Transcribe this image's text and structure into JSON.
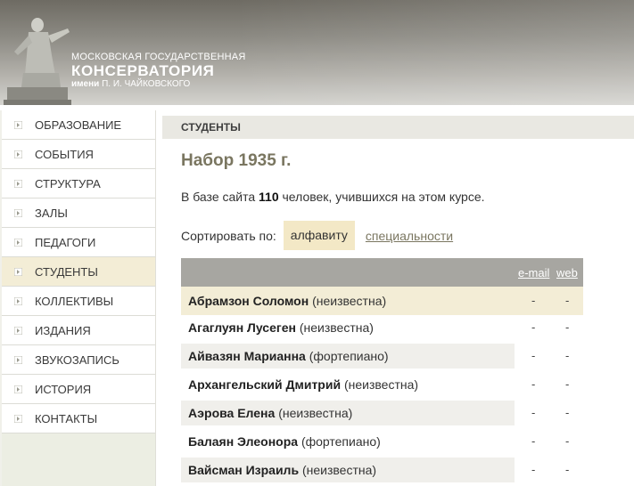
{
  "logo": {
    "line1": "МОСКОВСКАЯ ГОСУДАРСТВЕННАЯ",
    "line2": "КОНСЕРВАТОРИЯ",
    "line3_prefix": "имени",
    "line3_name": "П. И. ЧАЙКОВСКОГО"
  },
  "nav": {
    "items": [
      {
        "label": "ОБРАЗОВАНИЕ"
      },
      {
        "label": "СОБЫТИЯ"
      },
      {
        "label": "СТРУКТУРА"
      },
      {
        "label": "ЗАЛЫ"
      },
      {
        "label": "ПЕДАГОГИ"
      },
      {
        "label": "СТУДЕНТЫ"
      },
      {
        "label": "КОЛЛЕКТИВЫ"
      },
      {
        "label": "ИЗДАНИЯ"
      },
      {
        "label": "ЗВУКОЗАПИСЬ"
      },
      {
        "label": "ИСТОРИЯ"
      },
      {
        "label": "КОНТАКТЫ"
      }
    ],
    "active_index": 5
  },
  "section": {
    "title": "СТУДЕНТЫ"
  },
  "page": {
    "title": "Набор 1935 г.",
    "intro_before": "В базе сайта",
    "count": "110",
    "intro_after": "человек, учившихся на этом курсе."
  },
  "sort": {
    "label": "Сортировать по:",
    "active": "алфавиту",
    "alt": "специальности"
  },
  "table": {
    "col_email": "e-mail",
    "col_web": "web",
    "rows": [
      {
        "name": "Абрамзон Соломон",
        "spec": "(неизвестна)",
        "email": "-",
        "web": "-"
      },
      {
        "name": "Агаглуян Лусеген",
        "spec": "(неизвестна)",
        "email": "-",
        "web": "-"
      },
      {
        "name": "Айвазян Марианна",
        "spec": "(фортепиано)",
        "email": "-",
        "web": "-"
      },
      {
        "name": "Архангельский Дмитрий",
        "spec": "(неизвестна)",
        "email": "-",
        "web": "-"
      },
      {
        "name": "Аэрова Елена",
        "spec": "(неизвестна)",
        "email": "-",
        "web": "-"
      },
      {
        "name": "Балаян Элеонора",
        "spec": "(фортепиано)",
        "email": "-",
        "web": "-"
      },
      {
        "name": "Вайсман Израиль",
        "spec": "(неизвестна)",
        "email": "-",
        "web": "-"
      }
    ]
  },
  "colors": {
    "accent": "#7a7660",
    "highlight": "#f3edd6",
    "table_header": "#a7a6a1"
  }
}
